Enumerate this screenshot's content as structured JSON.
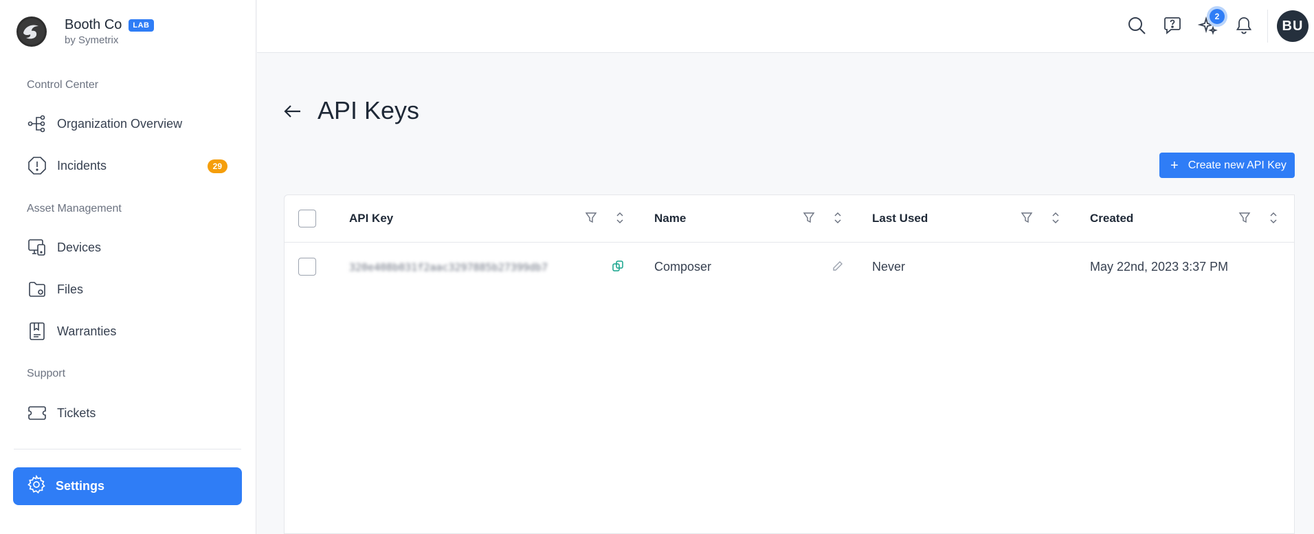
{
  "brand": {
    "name": "Booth Co",
    "badge": "LAB",
    "subtitle": "by Symetrix"
  },
  "sidebar": {
    "sections": [
      {
        "label": "Control Center"
      },
      {
        "label": "Asset Management"
      },
      {
        "label": "Support"
      }
    ],
    "items": [
      {
        "label": "Organization Overview",
        "icon": "org-tree-icon"
      },
      {
        "label": "Incidents",
        "icon": "alert-shield-icon",
        "count": "29"
      },
      {
        "label": "Devices",
        "icon": "devices-icon"
      },
      {
        "label": "Files",
        "icon": "folder-icon"
      },
      {
        "label": "Warranties",
        "icon": "warranty-icon"
      },
      {
        "label": "Tickets",
        "icon": "ticket-icon"
      }
    ],
    "settings": {
      "label": "Settings",
      "icon": "gear-icon"
    }
  },
  "topbar": {
    "notification_count": "2",
    "avatar_initials": "BU",
    "icons": [
      "search-icon",
      "help-chat-icon",
      "sparkles-icon",
      "bell-icon"
    ]
  },
  "page": {
    "title": "API Keys",
    "create_button": "Create new API Key"
  },
  "table": {
    "columns": [
      "API Key",
      "Name",
      "Last Used",
      "Created"
    ],
    "rows": [
      {
        "api_key": "320e408b031f2aac3297885b27399db7",
        "name": "Composer",
        "last_used": "Never",
        "created": "May 22nd, 2023 3:37 PM"
      }
    ]
  },
  "colors": {
    "accent": "#2f7df6",
    "badge_orange": "#f59e0b",
    "avatar_bg": "#25303d"
  }
}
